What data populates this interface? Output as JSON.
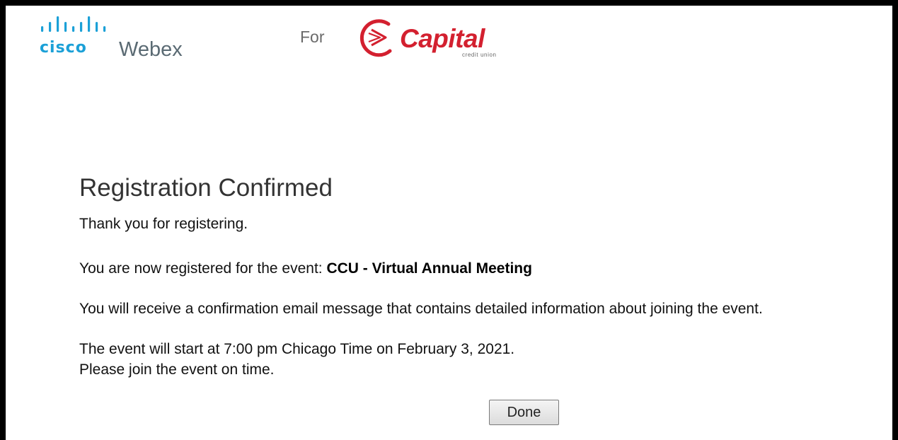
{
  "header": {
    "cisco_word": "cisco",
    "webex_word": "Webex",
    "for_label": "For",
    "capital_word": "Capital",
    "capital_sub": "credit union"
  },
  "content": {
    "title": "Registration Confirmed",
    "thanks": "Thank you for registering.",
    "registered_prefix": "You are now registered for the event: ",
    "event_name": "CCU - Virtual Annual Meeting",
    "email_notice": "You will receive a confirmation email message that contains detailed information about joining the event.",
    "start_notice": "The event will start at 7:00 pm Chicago Time on February 3, 2021.",
    "join_notice": "Please join the event on time."
  },
  "actions": {
    "done_label": "Done"
  },
  "colors": {
    "cisco_blue": "#1ba0d7",
    "capital_red": "#d3202f"
  },
  "icons": {
    "cisco_logo": "cisco-bars-icon",
    "capital_logo": "capital-swoosh-icon"
  }
}
